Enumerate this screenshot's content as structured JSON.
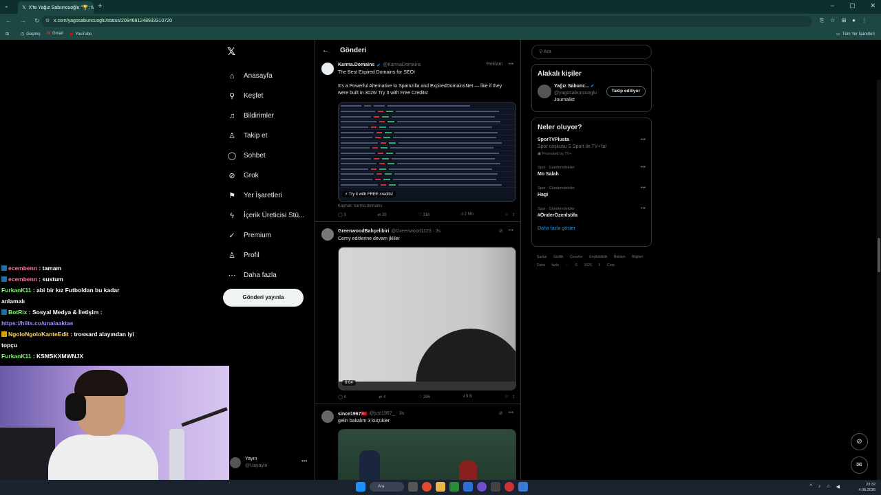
{
  "browser": {
    "tab_title": "X'te Yağız Sabuncuoğlu \"🏆: M",
    "url": "x.com/yagosabuncuoglu/status/2084681248933310720",
    "bookmarks": [
      "Geçmiş",
      "Gmail",
      "YouTube"
    ],
    "all_bookmarks": "Tüm Yer İşaretleri"
  },
  "nav": {
    "items": [
      {
        "label": "Anasayfa",
        "icon": "home-icon",
        "glyph": "⌂"
      },
      {
        "label": "Keşfet",
        "icon": "search-icon",
        "glyph": "⚲"
      },
      {
        "label": "Bildirimler",
        "icon": "bell-icon",
        "glyph": "♫"
      },
      {
        "label": "Takip et",
        "icon": "person-icon",
        "glyph": "♙"
      },
      {
        "label": "Sohbet",
        "icon": "chat-icon",
        "glyph": "◯"
      },
      {
        "label": "Grok",
        "icon": "grok-icon",
        "glyph": "⊘"
      },
      {
        "label": "Yer İşaretleri",
        "icon": "bookmark-icon",
        "glyph": "⚑"
      },
      {
        "label": "İçerik Üreticisi Stü...",
        "icon": "lightning-icon",
        "glyph": "ϟ"
      },
      {
        "label": "Premium",
        "icon": "verified-icon",
        "glyph": "✓"
      },
      {
        "label": "Profil",
        "icon": "profile-icon",
        "glyph": "♙"
      },
      {
        "label": "Daha fazla",
        "icon": "more-circle-icon",
        "glyph": "⋯"
      }
    ],
    "post_button": "Gönderi yayınla",
    "account": {
      "name": "Yayın",
      "handle": "@Uayayin"
    }
  },
  "main": {
    "title": "Gönderi",
    "tweets": [
      {
        "name": "Karma.Domains",
        "handle": "@KarmaDomains",
        "meta": "Reklam",
        "line1": "The Best Expired Domains for SEO!",
        "line2": "It's a Powerful Alternative to Spamzilla and ExpiredDomainsNet — like if they were built in 3026! Try It with Free Credits!",
        "media_badge": "⚡ Try it with FREE credits!",
        "source": "Kaynak: karma.domains",
        "replies": "3",
        "reposts": "35",
        "likes": "316",
        "views": "2 Mn"
      },
      {
        "name": "GreenwoodBahçelibiri",
        "handle": "@Greenwood1123 · 3s",
        "text": "Cerny editlerine devam jkliler",
        "duration": "0:04",
        "replies": "4",
        "reposts": "4",
        "likes": "296",
        "views": "9 B"
      },
      {
        "name": "since1967🇹🇷",
        "handle": "@just1967_ · 3s",
        "text": "gelin bakalım 3 küçükler"
      }
    ]
  },
  "right": {
    "search_placeholder": "Ara",
    "related_title": "Alakalı kişiler",
    "person": {
      "name": "Yağız Sabunc...",
      "handle": "@yagosabuncuoglu",
      "bio": "Journalist",
      "follow": "Takip ediliyor"
    },
    "trends_title": "Neler oluyor?",
    "trends": [
      {
        "cat": "",
        "name": "SporTVPlusta",
        "desc": "Spor coşkusu S Sport ile TV+'ta!",
        "promo": "Promoted by TV+"
      },
      {
        "cat": "Spor · Gündemdekiler",
        "name": "Mo Salah"
      },
      {
        "cat": "Spor · Gündemdekiler",
        "name": "Hagi"
      },
      {
        "cat": "Spor · Gündemdekiler",
        "name": "#ÖnderÖzenİstifa"
      }
    ],
    "show_more": "Daha fazla göster",
    "footer": "Şartlar Gizlilik Çerezler Erişilebilirlik Reklam Bilgileri Daha fazla ··· © 2026 X Corp."
  },
  "chat": [
    {
      "user": "ecembenn",
      "msg": ": tamam"
    },
    {
      "user": "ecembenn",
      "msg": ": sustum"
    },
    {
      "user": "FurkanK11",
      "msg": ": abi bir kız Futboldan bu kadar anlamalı"
    },
    {
      "user": "BotRix",
      "msg": ": Sosyal Medya & İletişim :",
      "link": "https://hiits.co/unalaaktas"
    },
    {
      "user": "NgoloNgoloKanteEdit",
      "msg": ": trossard alayından iyi topçu"
    },
    {
      "user": "FurkanK11",
      "msg": ": KSMSKXMWNJX"
    }
  ],
  "taskbar": {
    "search": "Ara",
    "time": "23:32",
    "date": "4.08.2026"
  }
}
